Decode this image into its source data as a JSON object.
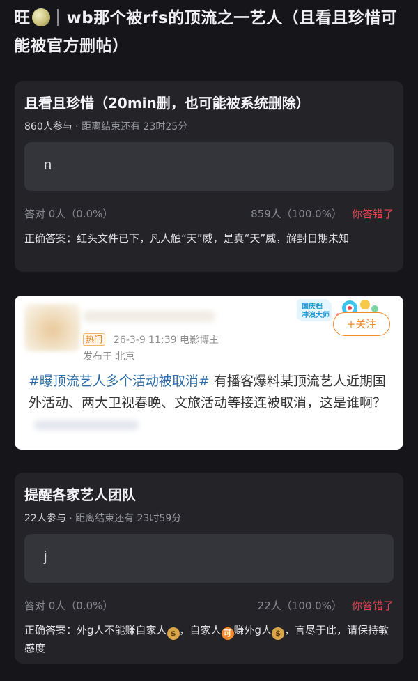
{
  "post": {
    "title_prefix": "旺",
    "title": "wb那个被rfs的顶流之一艺人（且看且珍惜可能被官方删帖）"
  },
  "polls": [
    {
      "title": "且看且珍惜（20min删，也可能被系统删除）",
      "participants": "860人参与",
      "time_left": " · 距离结束还有 23时25分",
      "answer_value": "n",
      "correct_stats": "答对  0人（0.0%）",
      "wrong_stats": "859人（100.0%）",
      "wrong_label": "你答错了",
      "correct_answer": "正确答案：红头文件已下，凡人触“天”威，是真“天”威，解封日期未知"
    },
    {
      "title": "提醒各家艺人团队",
      "participants": "22人参与",
      "time_left": " · 距离结束还有 23时59分",
      "answer_value": "j",
      "correct_stats": "答对  0人（0.0%）",
      "wrong_stats": "22人（100.0%）",
      "wrong_label": "你答错了",
      "correct_answer_parts": [
        "正确答案：外g人不能赚自家人",
        "，自家人",
        "赚外g人",
        "，言尽于此，请保持敏感度"
      ]
    }
  ],
  "weibo": {
    "tag": "热门",
    "time_source": "26-3-9 11:39  电影博主",
    "location": "发布于 北京",
    "badge": "国庆档\n冲浪大师",
    "follow_label": "+关注",
    "topic": "#曝顶流艺人多个活动被取消#",
    "text": " 有播客爆料某顶流艺人近期国外活动、两大卫视春晚、文旅活动等接连被取消，这是谁啊？"
  },
  "colors": {
    "background": "#16161a",
    "card": "#232328",
    "wrong": "#e8434f",
    "follow": "#f28a2a",
    "topic": "#2e6da8"
  },
  "icons": [
    "melon-icon",
    "money-bag-icon",
    "ke-coin-icon"
  ]
}
